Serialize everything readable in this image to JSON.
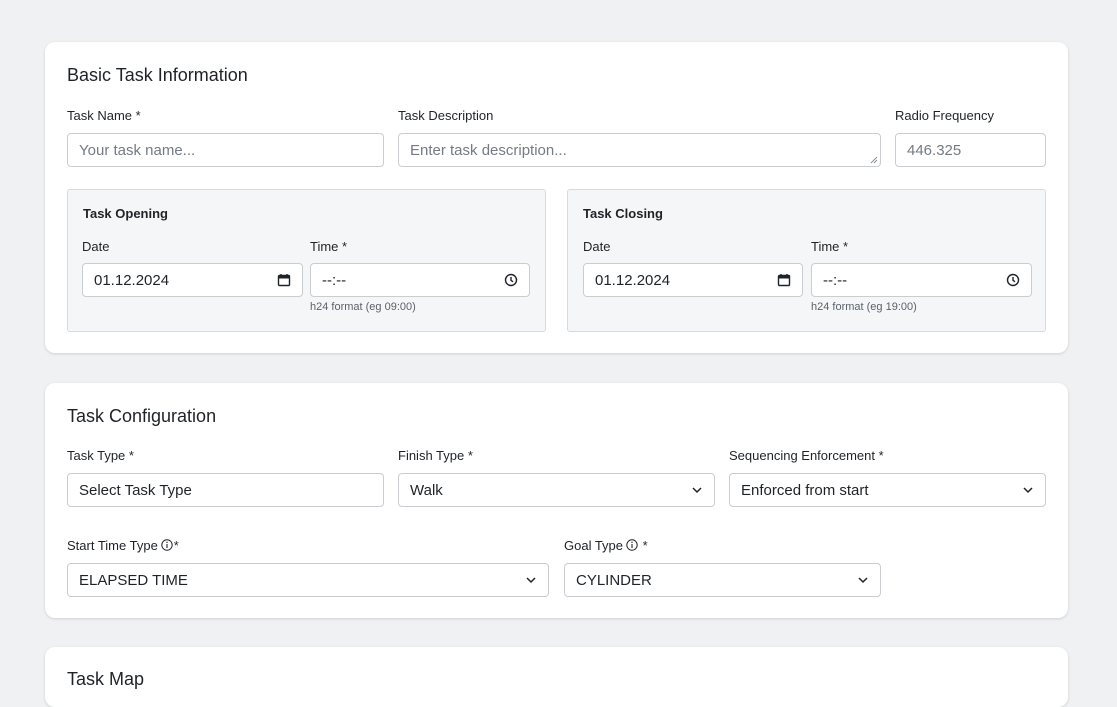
{
  "basic": {
    "title": "Basic Task Information",
    "task_name_label": "Task Name *",
    "task_name_placeholder": "Your task name...",
    "task_description_label": "Task Description",
    "task_description_placeholder": "Enter task description...",
    "radio_frequency_label": "Radio Frequency",
    "radio_frequency_placeholder": "446.325",
    "opening": {
      "title": "Task Opening",
      "date_label": "Date",
      "date_value": "01.12.2024",
      "time_label": "Time *",
      "time_value": "--:--",
      "hint": "h24 format (eg 09:00)"
    },
    "closing": {
      "title": "Task Closing",
      "date_label": "Date",
      "date_value": "01.12.2024",
      "time_label": "Time *",
      "time_value": "--:--",
      "hint": "h24 format (eg 19:00)"
    }
  },
  "config": {
    "title": "Task Configuration",
    "task_type_label": "Task Type *",
    "task_type_value": "Select Task Type",
    "finish_type_label": "Finish Type *",
    "finish_type_value": "Walk",
    "sequencing_label": "Sequencing Enforcement *",
    "sequencing_value": "Enforced from start",
    "start_time_type_label": "Start Time Type",
    "start_time_type_suffix": "*",
    "start_time_type_value": "ELAPSED TIME",
    "goal_type_label": "Goal Type",
    "goal_type_suffix": " *",
    "goal_type_value": "CYLINDER"
  },
  "map": {
    "title": "Task Map"
  }
}
